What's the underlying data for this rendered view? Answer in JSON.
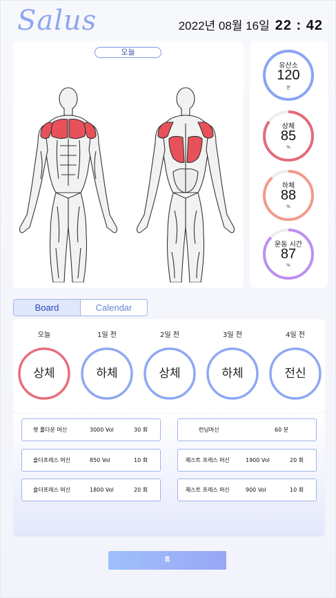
{
  "header": {
    "logo": "Salus",
    "date": "2022년 08월 16일",
    "time": "22 : 42"
  },
  "body_map": {
    "day_pill": "오늘",
    "highlighted_front": [
      "chest",
      "front-shoulders"
    ],
    "highlighted_back": [
      "upper-back",
      "lats"
    ],
    "highlight_color": "#e8515a"
  },
  "stats": [
    {
      "label": "유산소",
      "value": "120",
      "unit": "분",
      "progress": 1.0,
      "color": "#8aa5f5"
    },
    {
      "label": "상체",
      "value": "85",
      "unit": "%",
      "progress": 0.85,
      "color": "#e26c7a"
    },
    {
      "label": "하체",
      "value": "88",
      "unit": "%",
      "progress": 0.88,
      "color": "#f29b8a"
    },
    {
      "label": "운동 시간",
      "value": "87",
      "unit": "%",
      "progress": 0.87,
      "color": "#bd8ff0"
    }
  ],
  "tabs": [
    {
      "label": "Board",
      "active": true
    },
    {
      "label": "Calendar",
      "active": false
    }
  ],
  "days": [
    {
      "label": "오늘",
      "part": "상체",
      "color": "#e86e7c"
    },
    {
      "label": "1일 전",
      "part": "하체",
      "color": "#8fa8f2"
    },
    {
      "label": "2일 전",
      "part": "상체",
      "color": "#8fa8f2"
    },
    {
      "label": "3일 전",
      "part": "하체",
      "color": "#8fa8f2"
    },
    {
      "label": "4일 전",
      "part": "전신",
      "color": "#8fa8f2"
    }
  ],
  "records": [
    {
      "name": "렛 풀다운 머신",
      "vol": "3000 Vol",
      "count": "30 회"
    },
    {
      "name": "런닝머신",
      "vol": "",
      "count": "60 분"
    },
    {
      "name": "숄더프레스 머신",
      "vol": "850 Vol",
      "count": "10 회"
    },
    {
      "name": "체스트 프레스 머신",
      "vol": "1900 Vol",
      "count": "20 회"
    },
    {
      "name": "숄더프레스 머신",
      "vol": "1800 Vol",
      "count": "20 회"
    },
    {
      "name": "체스트 프레스 머신",
      "vol": "900 Vol",
      "count": "10 회"
    }
  ],
  "footer": {
    "rest_label": "휴"
  }
}
